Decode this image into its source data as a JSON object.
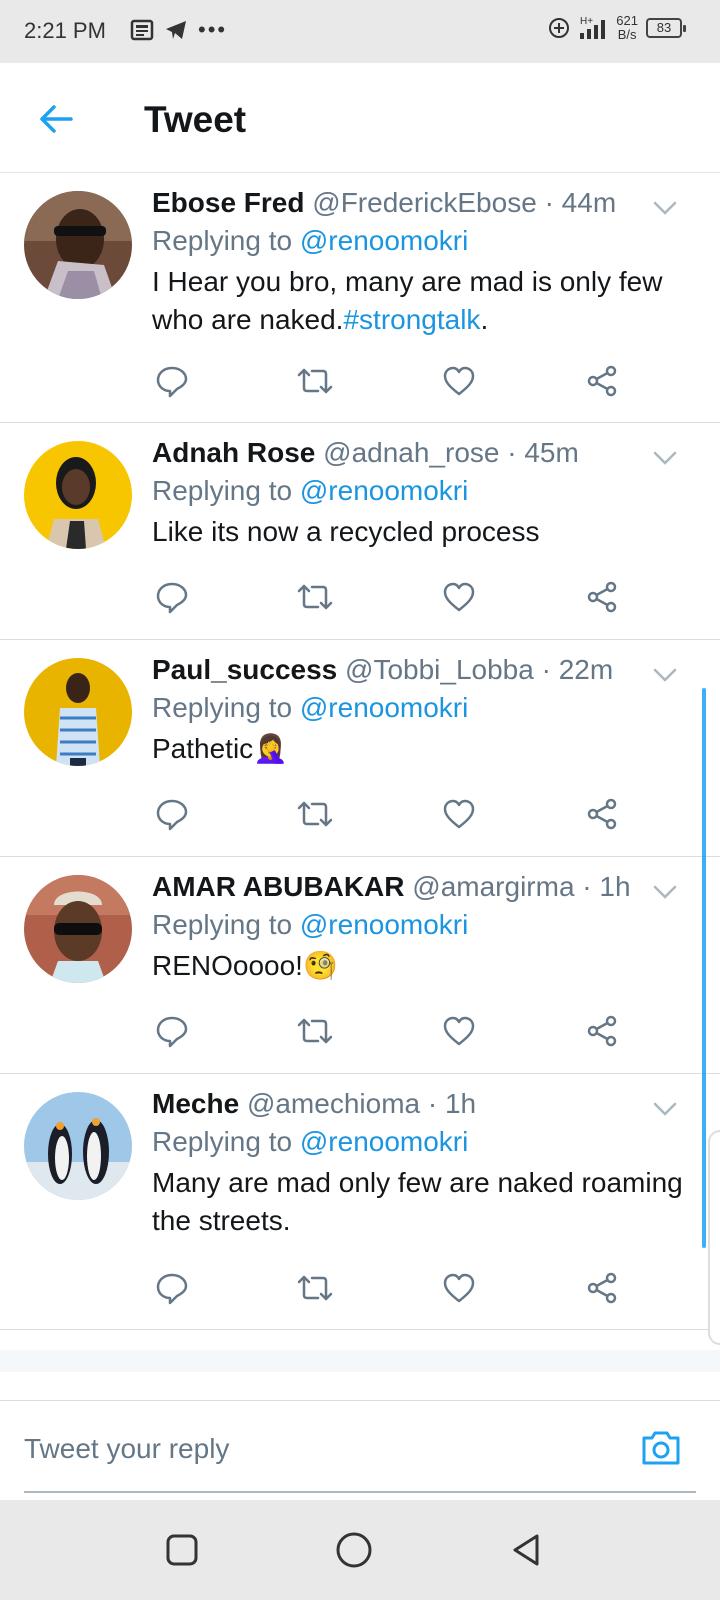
{
  "status_bar": {
    "time": "2:21 PM",
    "dots": "•••",
    "net_type": "H+",
    "speed_value": "621",
    "speed_unit": "B/s",
    "battery": "83"
  },
  "header": {
    "title": "Tweet",
    "back_icon": "arrow-left-icon"
  },
  "colors": {
    "accent": "#1da1f2",
    "link": "#1b95e0",
    "secondary_text": "#657786",
    "primary_text": "#14171a"
  },
  "tweets": [
    {
      "name": "Ebose Fred",
      "handle": "@FrederickEbose",
      "sep": "·",
      "time": "44m",
      "replying_prefix": "Replying to",
      "replying_to": "@renoomokri",
      "text": "I Hear you bro, many are mad is only few who are naked.",
      "hashtag": "#strongtalk",
      "text_tail": "."
    },
    {
      "name": "Adnah Rose",
      "handle": "@adnah_rose",
      "sep": "·",
      "time": "45m",
      "replying_prefix": "Replying to",
      "replying_to": "@renoomokri",
      "text": "Like its now a recycled process"
    },
    {
      "name": "Paul_success",
      "handle": "@Tobbi_Lobba",
      "sep": "·",
      "time": "22m",
      "replying_prefix": "Replying to",
      "replying_to": "@renoomokri",
      "text": "Pathetic🤦‍♀️"
    },
    {
      "name": "AMAR ABUBAKAR",
      "handle": "@amargirma",
      "sep": "·",
      "time": "1h",
      "replying_prefix": "Replying to",
      "replying_to": "@renoomokri",
      "text": "RENOoooo!🧐"
    },
    {
      "name": "Meche",
      "handle": "@amechioma",
      "sep": "·",
      "time": "1h",
      "replying_prefix": "Replying to",
      "replying_to": "@renoomokri",
      "text": "Many are mad only few are naked roaming the streets."
    }
  ],
  "reply_bar": {
    "placeholder": "Tweet your reply",
    "camera_icon": "camera-icon"
  },
  "nav_bar": {
    "recents_icon": "square-icon",
    "home_icon": "circle-icon",
    "back_icon": "triangle-back-icon"
  }
}
